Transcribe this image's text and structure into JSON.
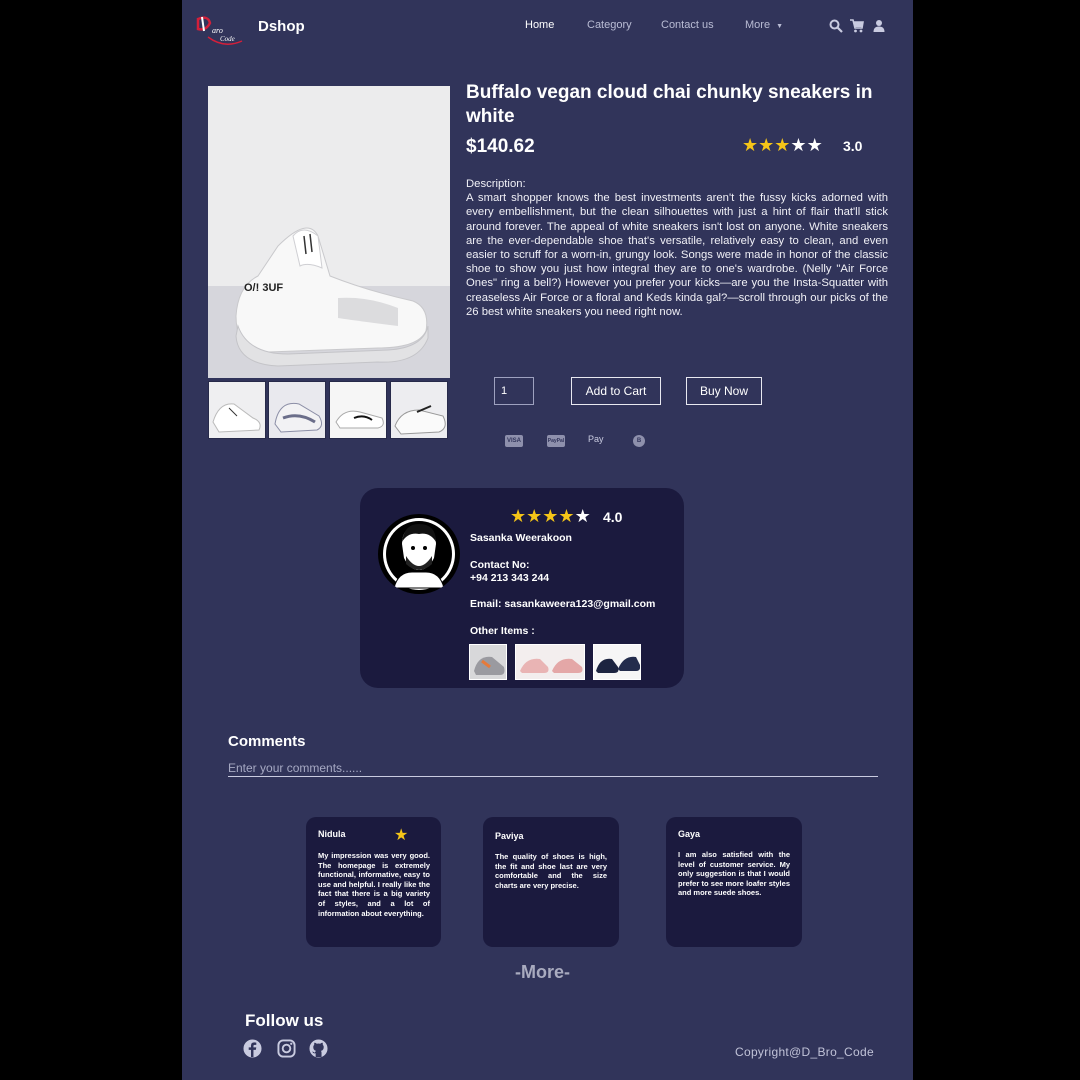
{
  "nav": {
    "brand": "Dshop",
    "logo_text": "D_Bro_Code",
    "links": [
      "Home",
      "Category",
      "Contact us",
      "More"
    ],
    "icons": [
      "search-icon",
      "cart-icon",
      "user-icon"
    ]
  },
  "product": {
    "title": "Buffalo vegan cloud chai chunky sneakers in white",
    "price": "$140.62",
    "rating": 3,
    "rating_text": "3.0",
    "description_label": "Description:",
    "description": "A smart shopper knows the best investments aren't the fussy kicks adorned with every embellishment, but the clean silhouettes with just a hint of flair that'll stick around forever. The appeal of white sneakers isn't lost on anyone. White sneakers are the ever-dependable shoe that's versatile, relatively easy to clean, and even easier to scruff for a worn-in, grungy look. Songs were made in honor of the classic shoe to show you just how integral they are to one's wardrobe. (Nelly \"Air Force Ones\" ring a bell?) However you prefer your kicks—are you the Insta-Squatter with creaseless Air Force or a floral and Keds kinda gal?—scroll through our picks of the 26 best white sneakers you need right now.",
    "quantity": "1",
    "add_to_cart": "Add to Cart",
    "buy_now": "Buy Now",
    "payments": [
      "VISA",
      "PayPal",
      "Pay",
      "B"
    ]
  },
  "seller": {
    "rating": 4,
    "rating_text": "4.0",
    "name": "Sasanka Weerakoon",
    "contact_label": "Contact No:",
    "contact": "+94 213 343 244",
    "email": "Email: sasankaweera123@gmail.com",
    "other_label": "Other Items :"
  },
  "comments": {
    "heading": "Comments",
    "placeholder": "Enter your comments......",
    "items": [
      {
        "name": "Nidula",
        "text": "My impression was very good. The homepage is extremely functional, informative, easy to use and helpful. I really like the fact that there is a big variety of styles, and a lot of information about everything."
      },
      {
        "name": "Paviya",
        "text": "The quality of shoes is high, the fit and shoe last are very comfortable and the size charts are very precise."
      },
      {
        "name": "Gaya",
        "text": "I am also satisfied with the level of customer service. My only suggestion is that I would prefer to see more loafer styles and more suede shoes."
      }
    ],
    "more": "-More-"
  },
  "footer": {
    "follow": "Follow us",
    "social": [
      "facebook-icon",
      "instagram-icon",
      "github-icon"
    ],
    "copyright": "Copyright@D_Bro_Code"
  },
  "colors": {
    "background": "#31345a",
    "card": "#1b1a3e",
    "star": "#f5c518"
  }
}
